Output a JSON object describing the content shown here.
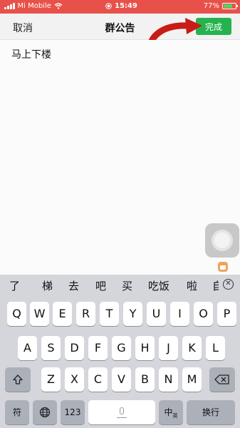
{
  "status": {
    "carrier": "Mi Mobile",
    "time": "15:49",
    "battery": "77%",
    "battery_level": 0.77
  },
  "nav": {
    "cancel": "取消",
    "title": "群公告",
    "done": "完成"
  },
  "editor": {
    "text": "马上下楼"
  },
  "keyboard": {
    "candidates": [
      "了",
      "梯",
      "去",
      "吧",
      "买",
      "吃饭",
      "啦",
      "自"
    ],
    "row1": [
      "Q",
      "W",
      "E",
      "R",
      "T",
      "Y",
      "U",
      "I",
      "O",
      "P"
    ],
    "row2": [
      "A",
      "S",
      "D",
      "F",
      "G",
      "H",
      "J",
      "K",
      "L"
    ],
    "row3": [
      "Z",
      "X",
      "C",
      "V",
      "B",
      "N",
      "M"
    ],
    "symbol_key": "符",
    "num_key": "123",
    "lang_key": "中",
    "lang_key_sub": "英",
    "return_key": "换行"
  },
  "colors": {
    "status_bar": "#e8514a",
    "done_button": "#25b34f",
    "annotation_arrow": "#c91b17"
  }
}
